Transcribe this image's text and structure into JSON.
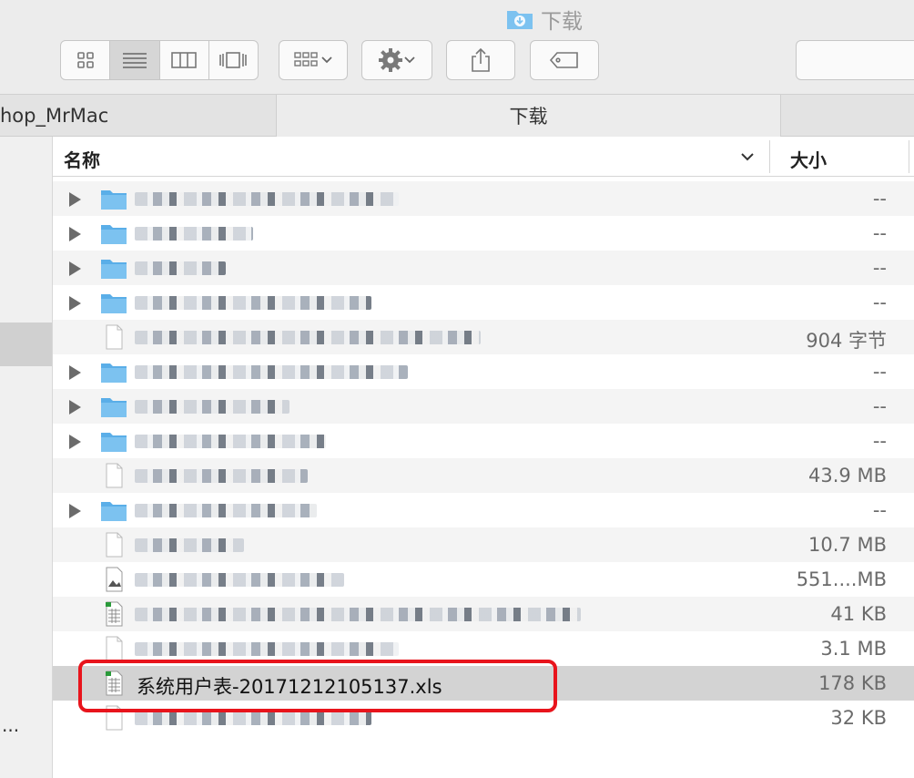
{
  "window": {
    "title": "下载"
  },
  "tabs": {
    "left": "hop_MrMac",
    "center": "下载"
  },
  "columns": {
    "name": "名称",
    "size": "大小"
  },
  "sidebar": {
    "more": "..."
  },
  "rows": [
    {
      "kind": "folder",
      "size": "--",
      "blur_width": 290
    },
    {
      "kind": "folder",
      "size": "--",
      "blur_width": 130
    },
    {
      "kind": "folder",
      "size": "--",
      "blur_width": 100
    },
    {
      "kind": "folder",
      "size": "--",
      "blur_width": 260
    },
    {
      "kind": "file",
      "size": "904 字节",
      "blur_width": 380
    },
    {
      "kind": "folder",
      "size": "--",
      "blur_width": 300
    },
    {
      "kind": "folder",
      "size": "--",
      "blur_width": 170
    },
    {
      "kind": "folder",
      "size": "--",
      "blur_width": 210
    },
    {
      "kind": "file",
      "size": "43.9 MB",
      "blur_width": 190
    },
    {
      "kind": "folder",
      "size": "--",
      "blur_width": 200
    },
    {
      "kind": "file",
      "size": "10.7 MB",
      "blur_width": 120
    },
    {
      "kind": "image",
      "size": "551....MB",
      "blur_width": 230
    },
    {
      "kind": "xls",
      "size": "41 KB",
      "blur_width": 490
    },
    {
      "kind": "file",
      "size": "3.1 MB",
      "blur_width": 290
    },
    {
      "kind": "xls",
      "size": "178 KB",
      "name": "系统用户表-20171212105137.xls",
      "selected": true
    },
    {
      "kind": "file",
      "size": "32 KB",
      "blur_width": 260
    }
  ],
  "colors": {
    "selection": "#d3d3d3",
    "highlight": "#e8141c",
    "folder": "#5aaee8"
  }
}
